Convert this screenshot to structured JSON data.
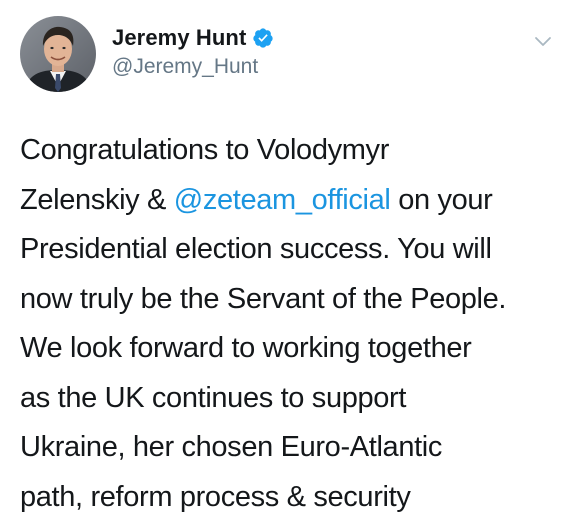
{
  "author": {
    "display_name": "Jeremy Hunt",
    "handle": "@Jeremy_Hunt",
    "verified": true,
    "avatar_icon": "avatar-photo"
  },
  "menu": {
    "icon": "chevron-down-icon"
  },
  "tweet": {
    "line_1": "Congratulations to Volodymyr",
    "line_2_pre": "Zelenskiy & ",
    "line_2_mention": "@zeteam_official",
    "line_2_post": " on your",
    "line_3": "Presidential election success. You will",
    "line_4": "now truly be the Servant of the People.",
    "line_5": "We look forward to working together",
    "line_6": "as the UK continues to support",
    "line_7": "Ukraine, her chosen Euro-Atlantic",
    "line_8": "path, reform process & security"
  },
  "colors": {
    "text": "#14171a",
    "secondary_text": "#657786",
    "link": "#1b95e0",
    "verified_badge": "#1da1f2",
    "chevron": "#aab8c2"
  }
}
